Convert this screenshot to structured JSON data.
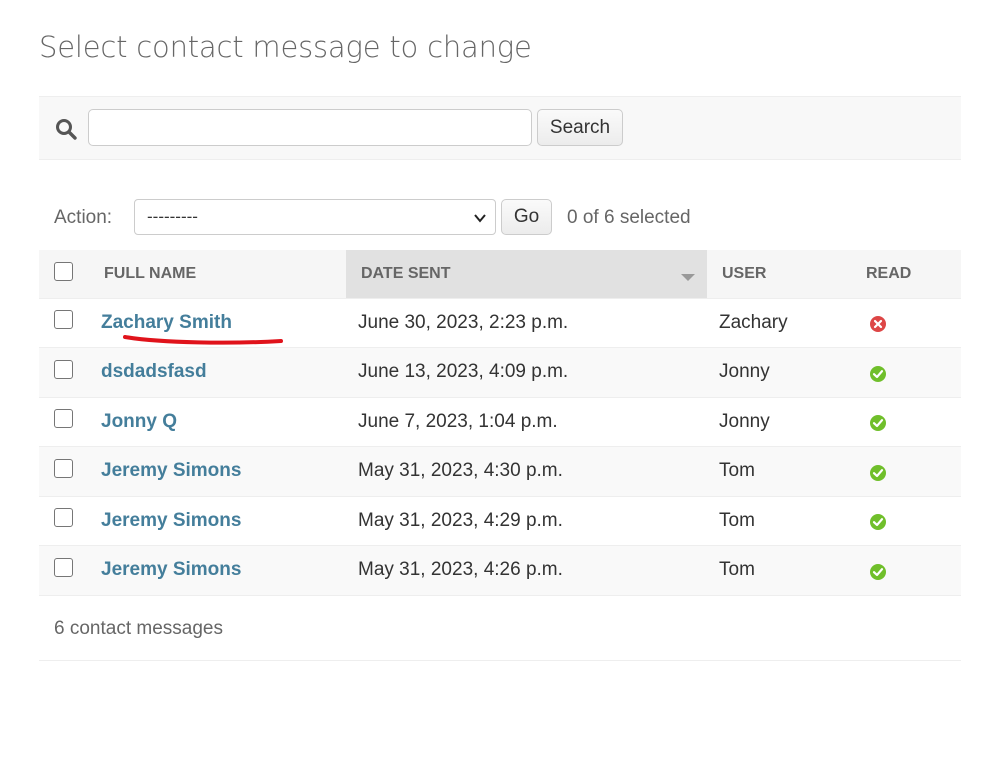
{
  "page": {
    "title": "Select contact message to change"
  },
  "search": {
    "value": "",
    "button_label": "Search"
  },
  "actions": {
    "label": "Action:",
    "selected_option": "---------",
    "go_label": "Go",
    "selection_counter": "0 of 6 selected"
  },
  "table": {
    "columns": [
      {
        "label": "Full name",
        "sorted": false
      },
      {
        "label": "Date sent",
        "sorted": true
      },
      {
        "label": "User",
        "sorted": false
      },
      {
        "label": "Read",
        "sorted": false
      }
    ],
    "rows": [
      {
        "full_name": "Zachary Smith",
        "date_sent": "June 30, 2023, 2:23 p.m.",
        "user": "Zachary",
        "read": false
      },
      {
        "full_name": "dsdadsfasd",
        "date_sent": "June 13, 2023, 4:09 p.m.",
        "user": "Jonny",
        "read": true
      },
      {
        "full_name": "Jonny Q",
        "date_sent": "June 7, 2023, 1:04 p.m.",
        "user": "Jonny",
        "read": true
      },
      {
        "full_name": "Jeremy Simons",
        "date_sent": "May 31, 2023, 4:30 p.m.",
        "user": "Tom",
        "read": true
      },
      {
        "full_name": "Jeremy Simons",
        "date_sent": "May 31, 2023, 4:29 p.m.",
        "user": "Tom",
        "read": true
      },
      {
        "full_name": "Jeremy Simons",
        "date_sent": "May 31, 2023, 4:26 p.m.",
        "user": "Tom",
        "read": true
      }
    ]
  },
  "footer": {
    "result_count": "6 contact messages"
  },
  "colors": {
    "link": "#447e9b",
    "read_yes": "#70bf2b",
    "read_no": "#dd4646",
    "annotation": "#e0131b"
  },
  "icons": {
    "search": "search-icon",
    "read_yes": "check-circle-icon",
    "read_no": "x-circle-icon",
    "select_arrow": "chevron-down-icon"
  }
}
